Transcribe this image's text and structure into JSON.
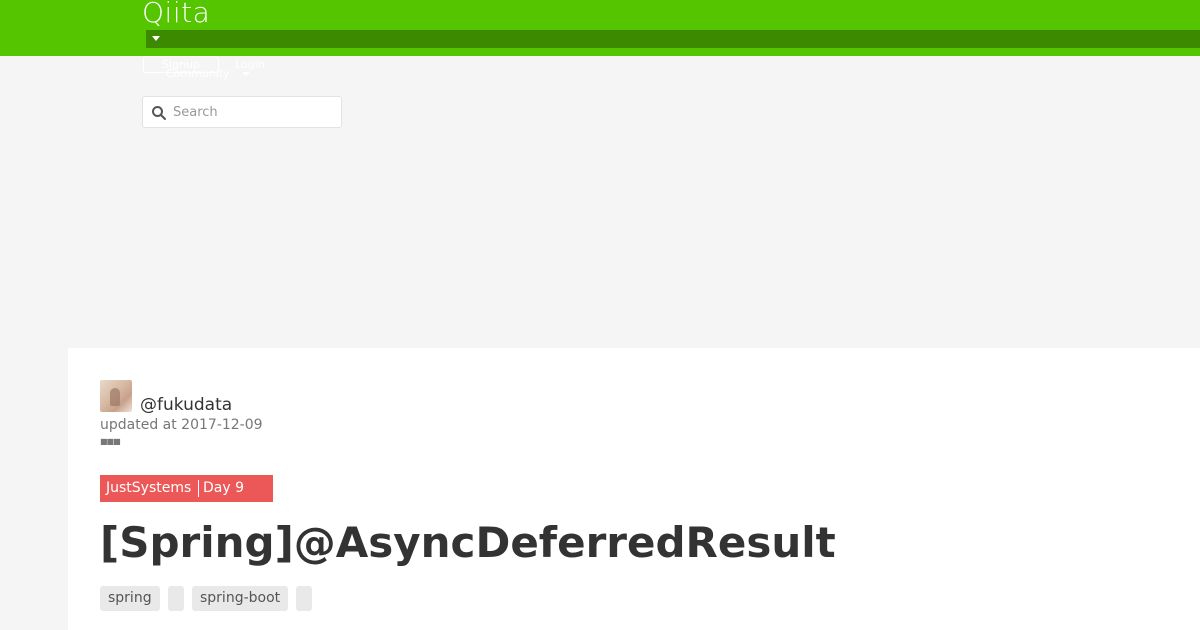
{
  "header": {
    "logo_text": "Qiita",
    "brand_color": "#55c500",
    "dropdown_bar_color": "#3b8a00",
    "signup_label": "Signup",
    "login_label": "Login",
    "community_label": "Community"
  },
  "search": {
    "placeholder": "Search",
    "value": ""
  },
  "article": {
    "author": "@fukudata",
    "updated_at": "updated at 2017-12-09",
    "calendar": {
      "name": "JustSystems",
      "day": "Day 9",
      "color": "#ec5858"
    },
    "title": "[Spring]@AsyncDeferredResult",
    "tags": [
      {
        "label": "spring"
      },
      {
        "label": ""
      },
      {
        "label": "spring-boot"
      },
      {
        "label": ""
      }
    ]
  },
  "icons": {
    "search": "search-icon",
    "dropdown": "caret-down-icon",
    "more": "more-dots-icon",
    "avatar": "avatar"
  }
}
